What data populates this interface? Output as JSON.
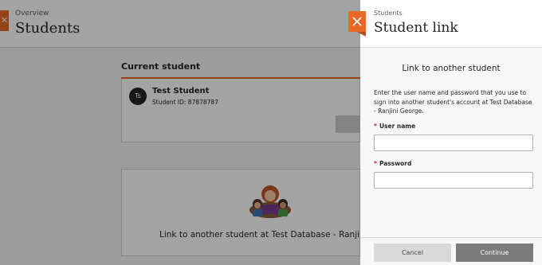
{
  "background": {
    "breadcrumb": "Overview",
    "title": "Students",
    "current_student_label": "Current student",
    "student": {
      "initials": "Ts",
      "name": "Test Student",
      "id_text": "Student ID: 87878787"
    },
    "link_heading": "Link to another student at Test Database - Ranjini G"
  },
  "panel": {
    "breadcrumb": "Students",
    "title": "Student link",
    "section_heading": "Link to another student",
    "instructions": "Enter the user name and password that you use to sign into another student's account at Test Database - Ranjini George.",
    "username": {
      "required_mark": "*",
      "label": "User name",
      "value": "",
      "placeholder": ""
    },
    "password": {
      "required_mark": "*",
      "label": "Password",
      "value": "",
      "placeholder": ""
    },
    "cancel_label": "Cancel",
    "continue_label": "Continue"
  },
  "colors": {
    "accent": "#e86826",
    "required": "#c22d1f",
    "continue_button": "#7a7a7a",
    "cancel_button": "#d9d9d9"
  },
  "icons": {
    "panel_close": "close-icon",
    "background_close": "close-icon",
    "avatar": "initials-avatar",
    "illustration": "student-group-illustration"
  }
}
